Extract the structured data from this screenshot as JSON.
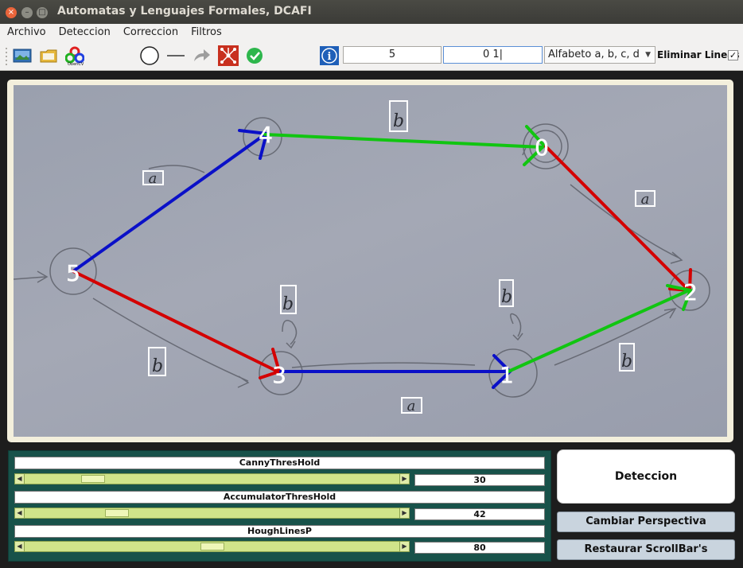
{
  "window": {
    "title": "Automatas y Lenguajes Formales, DCAFI"
  },
  "menu": {
    "items": [
      "Archivo",
      "Deteccion",
      "Correccion",
      "Filtros"
    ]
  },
  "toolbar": {
    "icons": [
      "image-icon",
      "folder-icon",
      "opencv-icon",
      "circle-tool-icon",
      "line-tool-icon",
      "arrow-tool-icon",
      "graph-icon",
      "check-icon",
      "info-icon"
    ],
    "field1_value": "5",
    "field2_value": "0 1|",
    "alphabet_select": "Alfabeto a, b, c, d",
    "eliminar_label": "Eliminar Lineas",
    "eliminar_checked": "✓"
  },
  "image": {
    "states": [
      "4",
      "0",
      "5",
      "2",
      "3",
      "1"
    ],
    "transition_labels": [
      "b",
      "a",
      "a",
      "b",
      "b",
      "b",
      "a",
      "b"
    ]
  },
  "sliders": [
    {
      "label": "CannyThresHold",
      "value": "30",
      "position": 0.16
    },
    {
      "label": "AccumulatorThresHold",
      "value": "42",
      "position": 0.23
    },
    {
      "label": "HoughLinesP",
      "value": "80",
      "position": 0.5
    }
  ],
  "buttons": {
    "deteccion": "Deteccion",
    "cambiar_perspectiva": "Cambiar Perspectiva",
    "restaurar": "Restaurar ScrollBar's"
  },
  "colors": {
    "accent_green": "#18524a",
    "edge_blue": "#0a10c8",
    "edge_red": "#d40000",
    "edge_green": "#11c511"
  }
}
